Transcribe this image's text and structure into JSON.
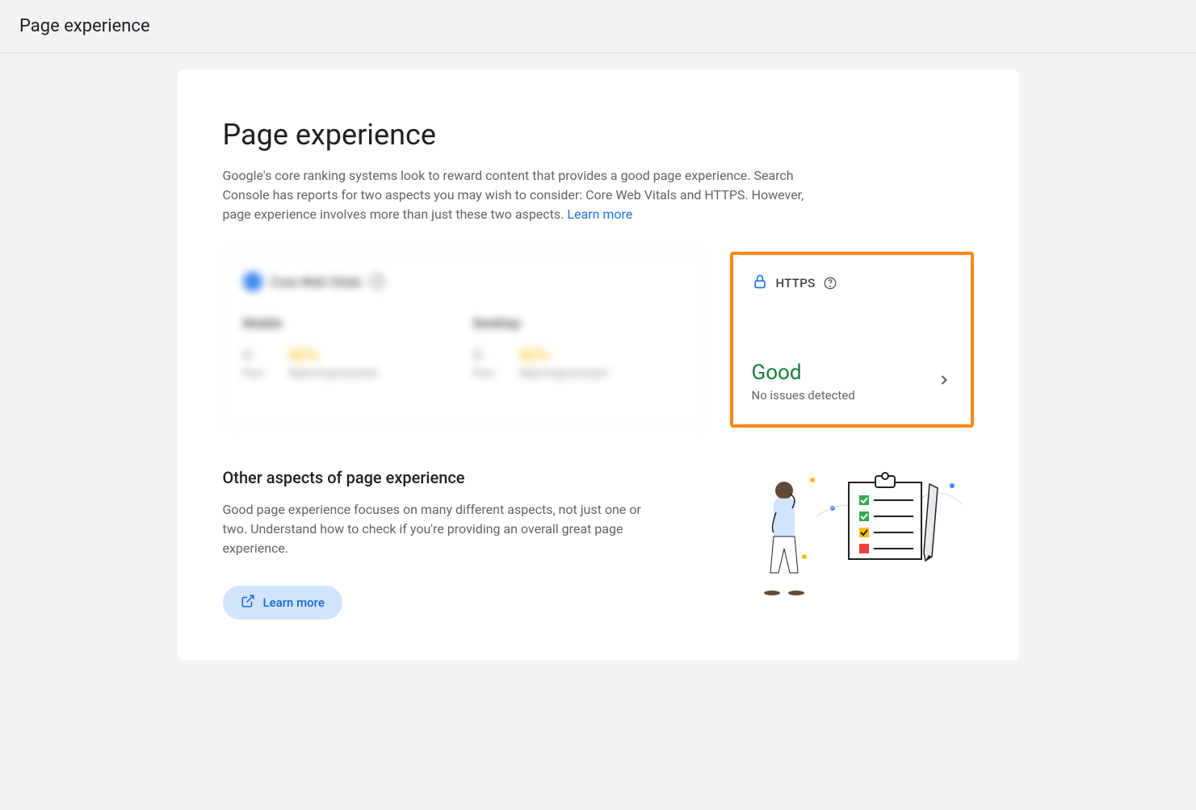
{
  "header": {
    "title": "Page experience"
  },
  "main": {
    "title": "Page experience",
    "description": "Google's core ranking systems look to reward content that provides a good page experience. Search Console has reports for two aspects you may wish to consider: Core Web Vitals and HTTPS. However, page experience involves more than just these two aspects. ",
    "learn_more_link": "Learn more"
  },
  "cwv_card": {
    "title": "Core Web Vitals",
    "mobile_label": "Mobile",
    "desktop_label": "Desktop",
    "poor_label": "Poor",
    "needs_improvement_label": "Need Improvement"
  },
  "https_card": {
    "title": "HTTPS",
    "status": "Good",
    "status_sub": "No issues detected"
  },
  "other": {
    "title": "Other aspects of page experience",
    "description": "Good page experience focuses on many different aspects, not just one or two. Understand how to check if you're providing an overall great page experience.",
    "learn_more_button": "Learn more"
  }
}
